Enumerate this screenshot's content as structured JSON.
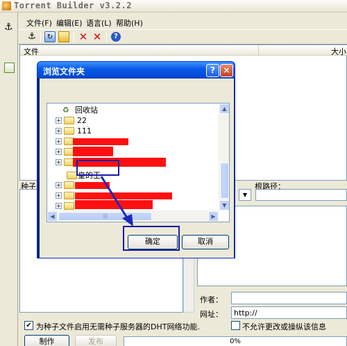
{
  "app": {
    "title": "Torrent Builder v3.2.2"
  },
  "menu": [
    "文件(F)",
    "编辑(E)",
    "语言(L)",
    "帮助(H)"
  ],
  "toolbar": {
    "icons": [
      "anchor-icon",
      "refresh-icon",
      "open-folder-icon",
      "delete-icon",
      "clear-icon",
      "help-icon"
    ]
  },
  "file_list": {
    "columns": [
      "文件",
      "大小"
    ]
  },
  "labels": {
    "seed": "种子",
    "root_path": "根路径：",
    "author": "作者：",
    "url": "网址："
  },
  "url_value": "http://",
  "dht_option": {
    "label": "为种子文件启用无需种子服务器的DHT网络功能.",
    "checked": true
  },
  "private_option": {
    "label": "不允许更改或操纵该信息"
  },
  "buttons": {
    "make": "制作",
    "publish": "发布"
  },
  "progress": {
    "text": "0%",
    "value": 0
  },
  "dialog": {
    "title": "浏览文件夹",
    "help": "?",
    "close": "×",
    "tree": [
      {
        "label": "回收站",
        "expander": ""
      },
      {
        "label": "22",
        "expander": "+"
      },
      {
        "label": "111",
        "expander": "+"
      },
      {
        "label": "",
        "expander": "+",
        "redacted": true
      },
      {
        "label": "",
        "expander": "+",
        "redacted": true
      },
      {
        "label": "",
        "expander": "+",
        "redacted": true
      },
      {
        "label": "皇的王",
        "expander": ""
      },
      {
        "label": "",
        "expander": "+",
        "redacted": true
      },
      {
        "label": "",
        "expander": "+",
        "redacted": true
      },
      {
        "label": "",
        "expander": "+",
        "redacted": true
      }
    ],
    "ok": "确定",
    "cancel": "取消"
  }
}
